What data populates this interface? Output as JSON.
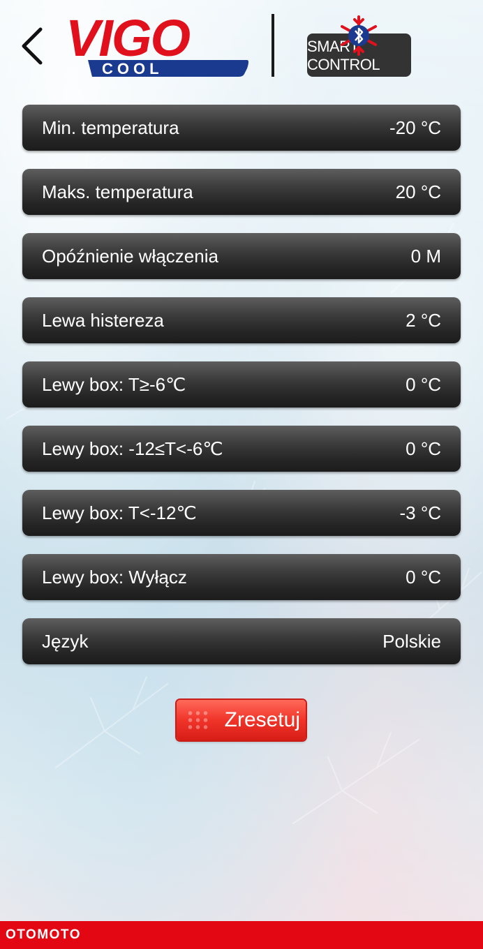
{
  "header": {
    "brand": "VIGO",
    "brand_sub": "COOL",
    "badge_label": "SMART CONTROL",
    "back_icon": "chevron-left-icon",
    "badge_icon": "bluetooth-snowflake-icon"
  },
  "settings": [
    {
      "label": "Min. temperatura",
      "value": "-20 °C"
    },
    {
      "label": "Maks. temperatura",
      "value": "20 °C"
    },
    {
      "label": "Opóźnienie włączenia",
      "value": "0 M"
    },
    {
      "label": "Lewa histereza",
      "value": "2 °C"
    },
    {
      "label": "Lewy box: T≥-6℃",
      "value": "0 °C"
    },
    {
      "label": "Lewy box: -12≤T<-6℃",
      "value": "0 °C"
    },
    {
      "label": "Lewy box: T<-12℃",
      "value": "-3 °C"
    },
    {
      "label": "Lewy box: Wyłącz",
      "value": "0 °C"
    },
    {
      "label": "Język",
      "value": "Polskie"
    }
  ],
  "reset_label": "Zresetuj",
  "footer": {
    "watermark": "OTOMOTO"
  },
  "colors": {
    "brand_red": "#e0111c",
    "brand_blue": "#1a3a8f",
    "row_dark": "#2a2a2a",
    "reset_red": "#f0342a",
    "footer_red": "#e30613"
  }
}
